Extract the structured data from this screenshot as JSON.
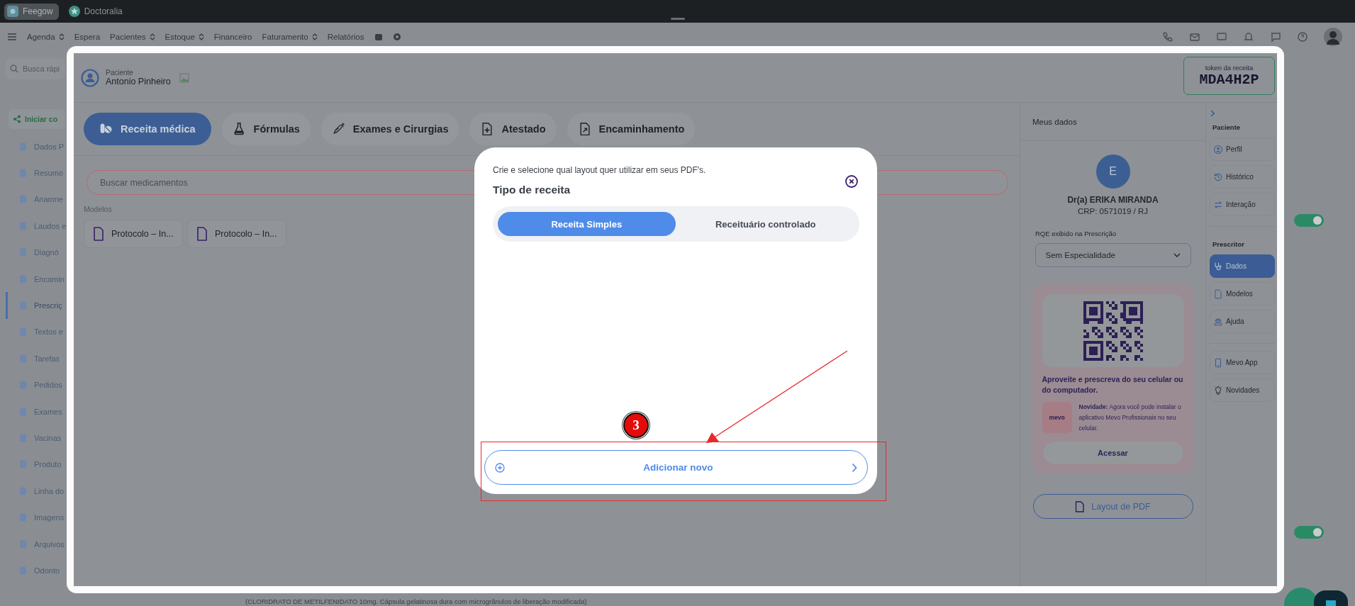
{
  "window_tabs": [
    {
      "label": "Feegow",
      "selected": true
    },
    {
      "label": "Doctoralia",
      "selected": false
    }
  ],
  "nav": {
    "items": [
      {
        "label": "Agenda",
        "dropdown": true
      },
      {
        "label": "Espera",
        "dropdown": false
      },
      {
        "label": "Pacientes",
        "dropdown": true
      },
      {
        "label": "Estoque",
        "dropdown": true
      },
      {
        "label": "Financeiro",
        "dropdown": false
      },
      {
        "label": "Faturamento",
        "dropdown": true
      },
      {
        "label": "Relatórios",
        "dropdown": false
      }
    ]
  },
  "quick_search": {
    "placeholder": "Busca rápi"
  },
  "sidebar": {
    "start_button": "Iniciar co",
    "items": [
      {
        "label": "Dados P",
        "selected": false
      },
      {
        "label": "Resumo",
        "selected": false
      },
      {
        "label": "Anamne",
        "selected": false
      },
      {
        "label": "Laudos e",
        "selected": false
      },
      {
        "label": "Diagnó",
        "selected": false
      },
      {
        "label": "Encamin",
        "selected": false
      },
      {
        "label": "Prescriç",
        "selected": true
      },
      {
        "label": "Textos e",
        "selected": false
      },
      {
        "label": "Tarefas",
        "selected": false
      },
      {
        "label": "Pedidos",
        "selected": false
      },
      {
        "label": "Exames",
        "selected": false
      },
      {
        "label": "Vacinas",
        "selected": false
      },
      {
        "label": "Produto",
        "selected": false
      },
      {
        "label": "Linha do",
        "selected": false
      },
      {
        "label": "Imagens",
        "selected": false
      },
      {
        "label": "Arquivos",
        "selected": false
      },
      {
        "label": "Odonto",
        "selected": false
      }
    ]
  },
  "background_toggles": [
    {
      "on": true
    },
    {
      "on": true
    }
  ],
  "background_text": "(CLORIDRATO DE METILFENIDATO 10mg. Cápsula gelatinosa dura com microgrânulos de liberação modificada)",
  "prescription": {
    "patient_label": "Paciente",
    "patient_name": "Antonio Pinheiro",
    "token_label": "token da receita",
    "token": "MDA4H2P",
    "tabs": [
      {
        "label": "Receita médica",
        "selected": true
      },
      {
        "label": "Fórmulas",
        "selected": false
      },
      {
        "label": "Exames e Cirurgias",
        "selected": false
      },
      {
        "label": "Atestado",
        "selected": false
      },
      {
        "label": "Encaminhamento",
        "selected": false
      }
    ],
    "search": {
      "placeholder": "Buscar medicamentos"
    },
    "models_label": "Modelos",
    "models": [
      "Protocolo – In...",
      "Protocolo – In..."
    ],
    "my_data": {
      "title": "Meus dados",
      "avatar_letter": "E",
      "doctor_name": "Dr(a) ERIKA MIRANDA",
      "registry": "CRP: 0571019 / RJ",
      "rqe_label": "RQE exibido na Prescrição",
      "rqe_value": "Sem Especialidade",
      "promo_text": "Aproveite e prescreva do seu celular ou do computador.",
      "app_badge": "mevo",
      "news_text": "**Novidade:** Agora você pode instalar o aplicativo Mevo Profissionais no seu celular.",
      "access_button": "Acessar",
      "layout_button": "Layout de PDF"
    },
    "side_nav": {
      "items": [
        {
          "kind": "heading",
          "label": "Paciente"
        },
        {
          "kind": "link",
          "label": "Perfil",
          "selected": false
        },
        {
          "kind": "link",
          "label": "Histórico",
          "selected": false
        },
        {
          "kind": "link",
          "label": "Interação",
          "selected": false
        },
        {
          "kind": "divider"
        },
        {
          "kind": "heading",
          "label": "Prescritor"
        },
        {
          "kind": "link",
          "label": "Dados",
          "selected": true
        },
        {
          "kind": "link",
          "label": "Modelos",
          "selected": false
        },
        {
          "kind": "link",
          "label": "Ajuda",
          "selected": false
        },
        {
          "kind": "divider"
        },
        {
          "kind": "link",
          "label": "Mevo App",
          "selected": false
        },
        {
          "kind": "link",
          "label": "Novidades",
          "selected": false
        }
      ]
    }
  },
  "dialog": {
    "description": "Crie e selecione qual layout quer utilizar em seus PDF's.",
    "title": "Tipo de receita",
    "options": [
      {
        "label": "Receita Simples",
        "selected": true
      },
      {
        "label": "Receituário controlado",
        "selected": false
      }
    ],
    "add_button": "Adicionar novo"
  },
  "annotation": {
    "badge": "3"
  }
}
